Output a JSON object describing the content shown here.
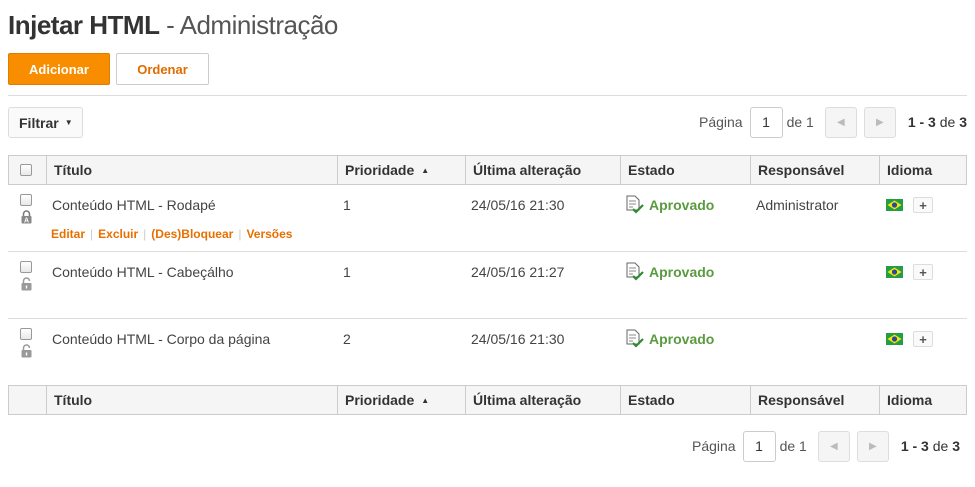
{
  "header": {
    "title_main": "Injetar HTML",
    "title_sep": " - ",
    "title_sub": "Administração"
  },
  "toolbar": {
    "add_label": "Adicionar",
    "order_label": "Ordenar"
  },
  "filter": {
    "label": "Filtrar"
  },
  "pager": {
    "page_label": "Página",
    "current_page": "1",
    "of_label": "de 1",
    "range_start_end": "1 - 3",
    "range_of": "de",
    "range_total": "3"
  },
  "table": {
    "columns": {
      "title": "Título",
      "priority": "Prioridade",
      "modified": "Última alteração",
      "state": "Estado",
      "responsible": "Responsável",
      "language": "Idioma"
    },
    "rows": [
      {
        "title": "Conteúdo HTML - Rodapé",
        "priority": "1",
        "modified": "24/05/16 21:30",
        "state": "Aprovado",
        "responsible": "Administrator"
      },
      {
        "title": "Conteúdo HTML - Cabeçálho",
        "priority": "1",
        "modified": "24/05/16 21:27",
        "state": "Aprovado",
        "responsible": ""
      },
      {
        "title": "Conteúdo HTML - Corpo da página",
        "priority": "2",
        "modified": "24/05/16 21:30",
        "state": "Aprovado",
        "responsible": ""
      }
    ],
    "row_actions": {
      "edit": "Editar",
      "delete": "Excluir",
      "lock": "(Des)Bloquear",
      "versions": "Versões"
    },
    "language_add": "+"
  },
  "colors": {
    "accent": "#f88d00",
    "link": "#e86f00",
    "approved": "#5a9b3f"
  }
}
